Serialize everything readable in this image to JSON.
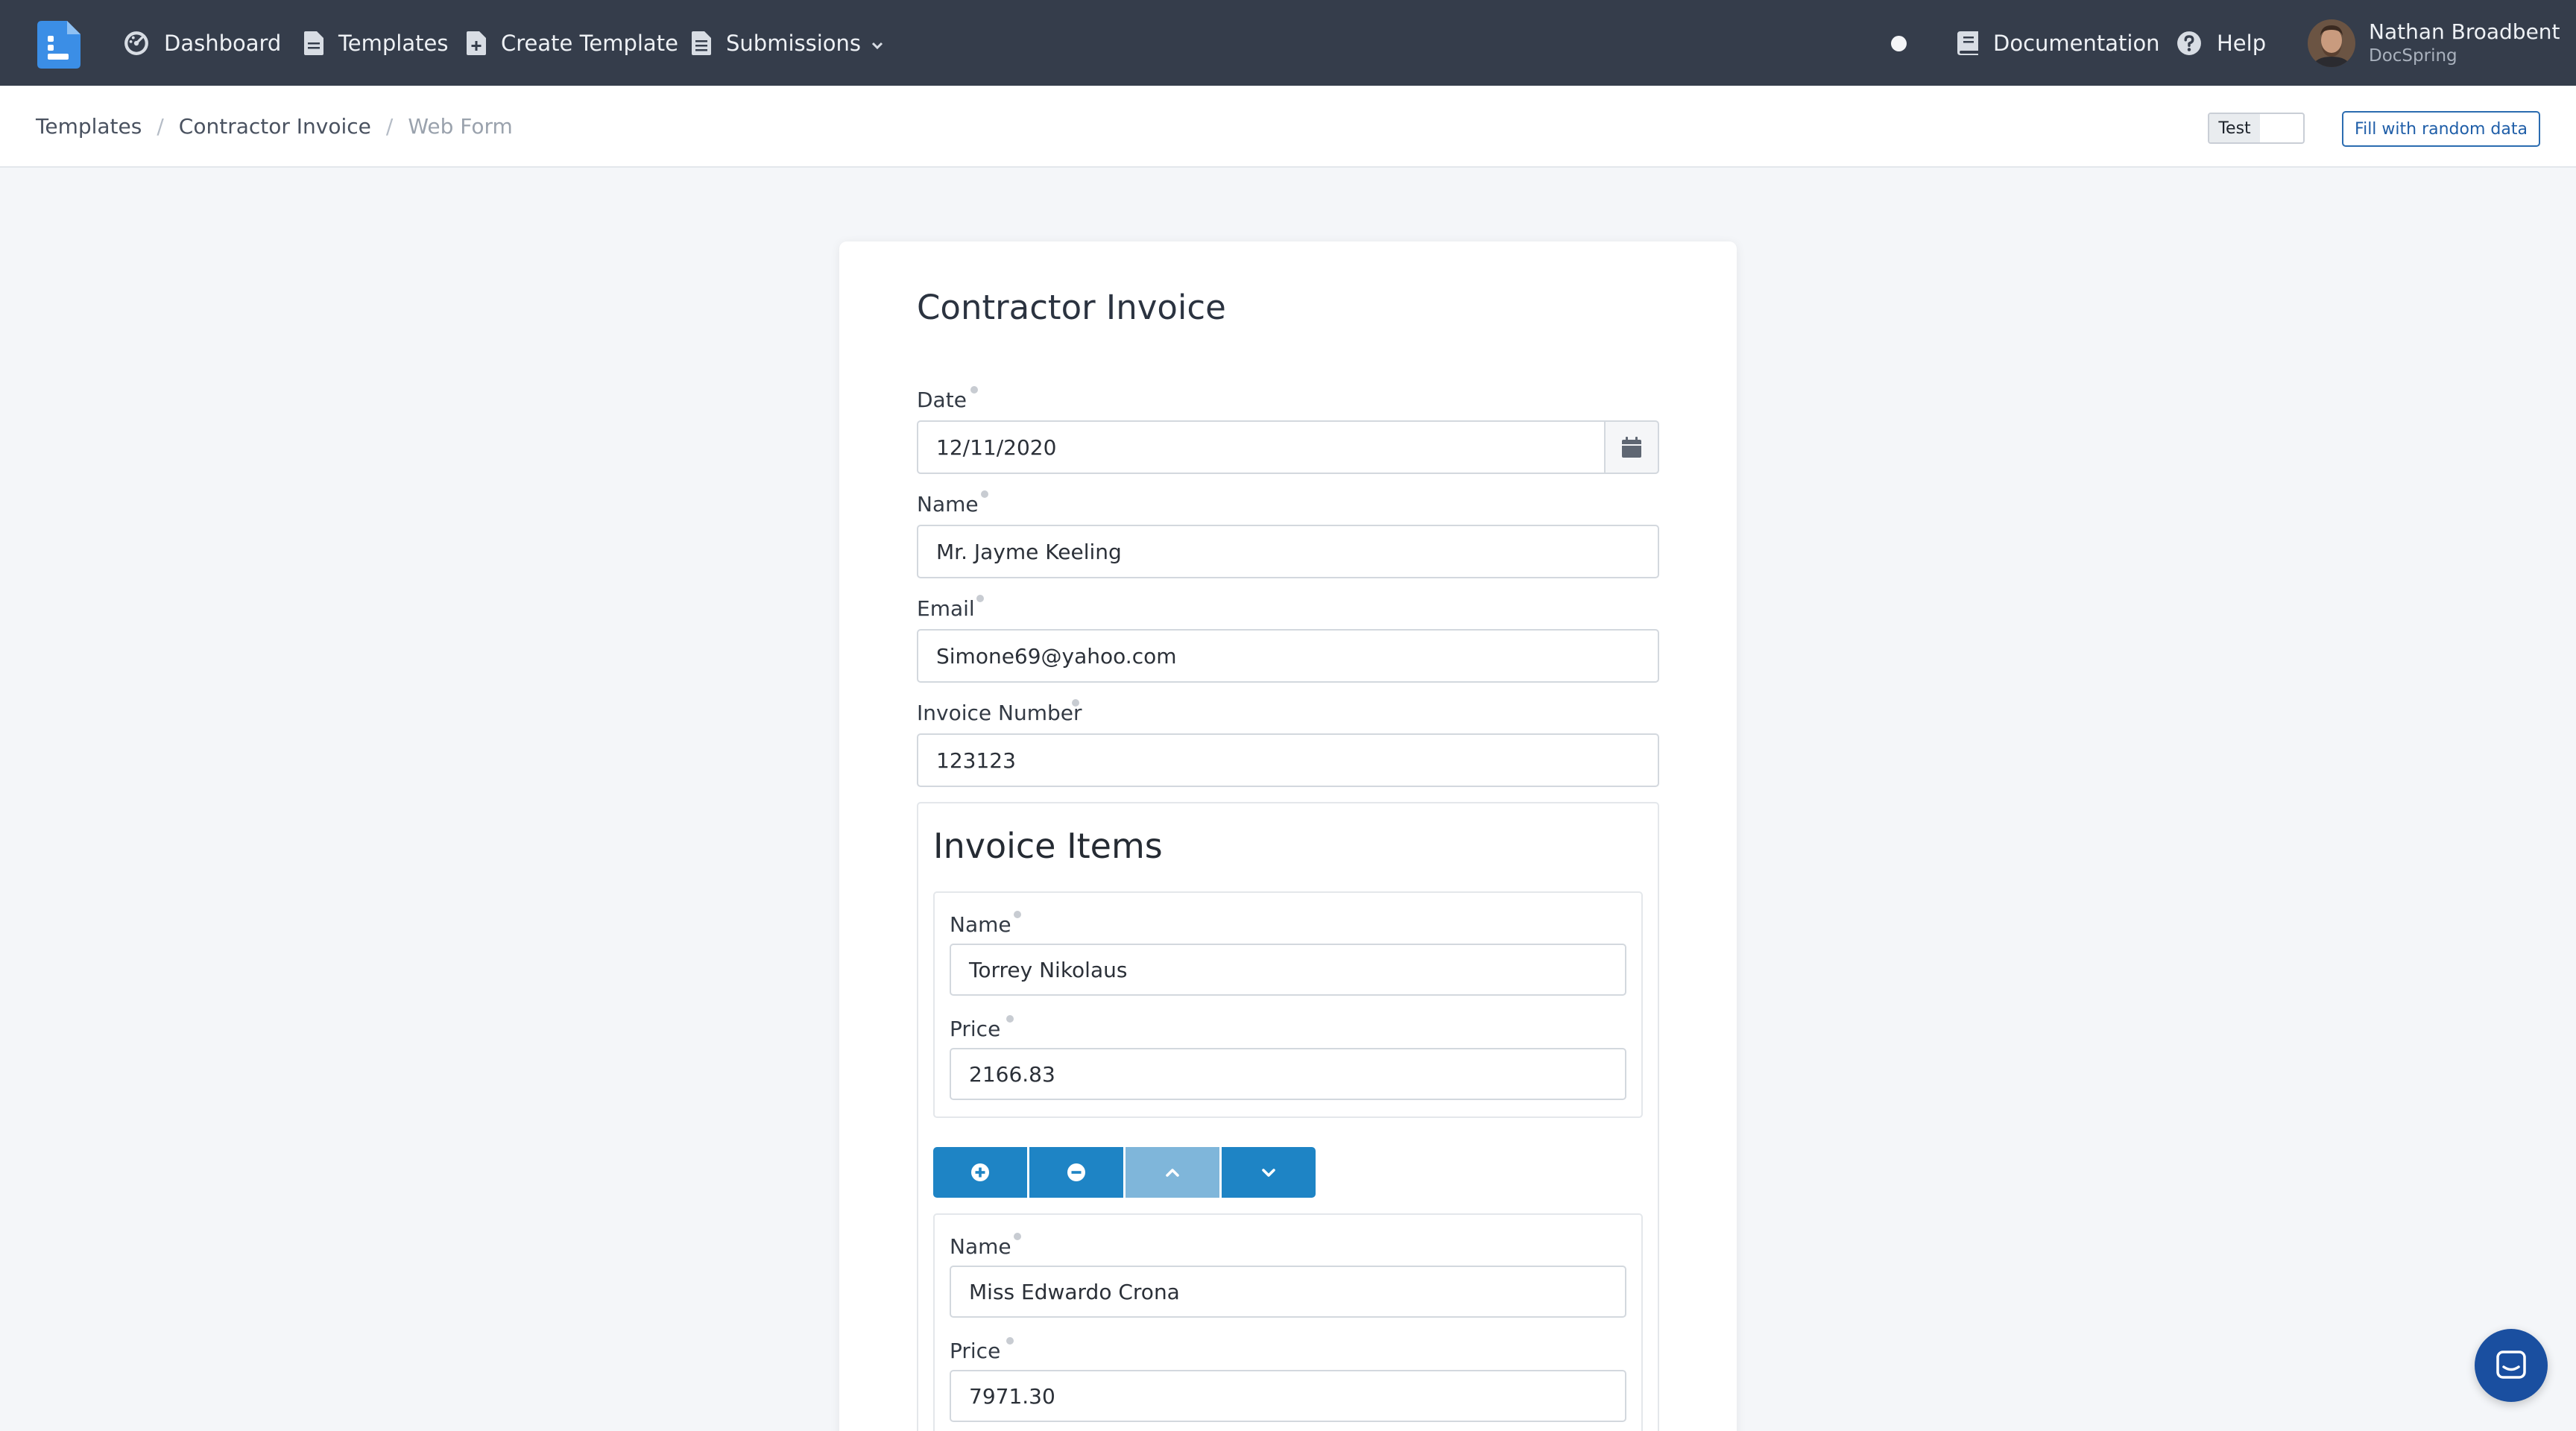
{
  "navbar": {
    "items": [
      {
        "label": "Dashboard",
        "icon": "dashboard-icon"
      },
      {
        "label": "Templates",
        "icon": "file-icon"
      },
      {
        "label": "Create Template",
        "icon": "file-plus-icon"
      },
      {
        "label": "Submissions",
        "icon": "file-lines-icon"
      }
    ],
    "documentation": "Documentation",
    "help": "Help",
    "user": {
      "name": "Nathan Broadbent",
      "org": "DocSpring"
    }
  },
  "breadcrumb": {
    "items": [
      "Templates",
      "Contractor Invoice",
      "Web Form"
    ],
    "separator": "/"
  },
  "toolbar": {
    "test_label": "Test",
    "fill_random_label": "Fill with random data"
  },
  "form": {
    "title": "Contractor Invoice",
    "fields": [
      {
        "label": "Date",
        "value": "12/11/2020"
      },
      {
        "label": "Name",
        "value": "Mr. Jayme Keeling"
      },
      {
        "label": "Email",
        "value": "Simone69@yahoo.com"
      },
      {
        "label": "Invoice Number",
        "value": "123123"
      }
    ],
    "invoice_items": {
      "title": "Invoice Items",
      "items": [
        {
          "name_label": "Name",
          "name": "Torrey Nikolaus",
          "price_label": "Price",
          "price": "2166.83"
        },
        {
          "name_label": "Name",
          "name": "Miss Edwardo Crona",
          "price_label": "Price",
          "price": "7971.30"
        }
      ]
    }
  },
  "colors": {
    "navbar": "#353d4b",
    "accent": "#1e84c5",
    "accent_disabled": "#7fb6da",
    "link": "#1f5ea8",
    "chat": "#1a4fa0"
  }
}
